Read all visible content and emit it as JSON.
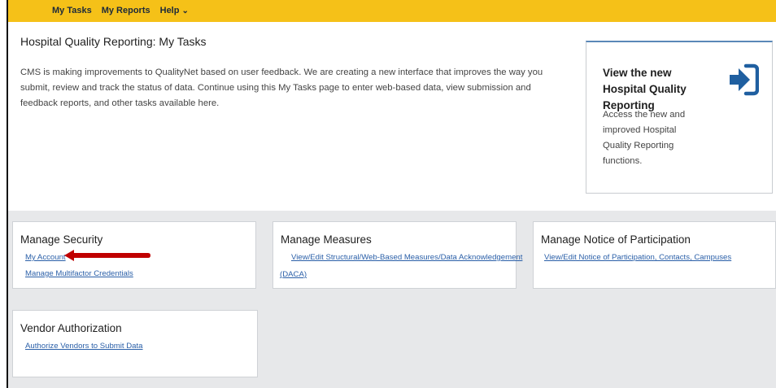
{
  "nav": {
    "my_tasks": "My Tasks",
    "my_reports": "My Reports",
    "help": "Help",
    "help_chevron": "⌄"
  },
  "page": {
    "title": "Hospital Quality Reporting: My Tasks",
    "intro": "CMS is making improvements to QualityNet based on user feedback. We are creating a new interface that improves the way you submit, review and track the status of data. Continue using this My Tasks page to enter web-based data, view submission and feedback reports, and other tasks available here."
  },
  "promo": {
    "title": "View the new Hospital Quality Reporting",
    "text": "Access the new and improved Hospital Quality Reporting functions.",
    "icon": "sign-in-icon"
  },
  "cards": {
    "security": {
      "title": "Manage Security",
      "link1": "My Account",
      "link2": "Manage Multifactor Credentials"
    },
    "measures": {
      "title": "Manage Measures",
      "link1a": "View/Edit Structural/Web-Based Measures/Data Acknowledgement",
      "link1b": "(DACA)"
    },
    "participation": {
      "title": "Manage Notice of Participation",
      "link1": "View/Edit Notice of Participation, Contacts, Campuses"
    },
    "vendor": {
      "title": "Vendor Authorization",
      "link1": "Authorize Vendors to Submit Data"
    }
  },
  "colors": {
    "topbar": "#f5c118",
    "link": "#2a5fa8",
    "arrow": "#c00000",
    "icon": "#1f5fa0"
  }
}
